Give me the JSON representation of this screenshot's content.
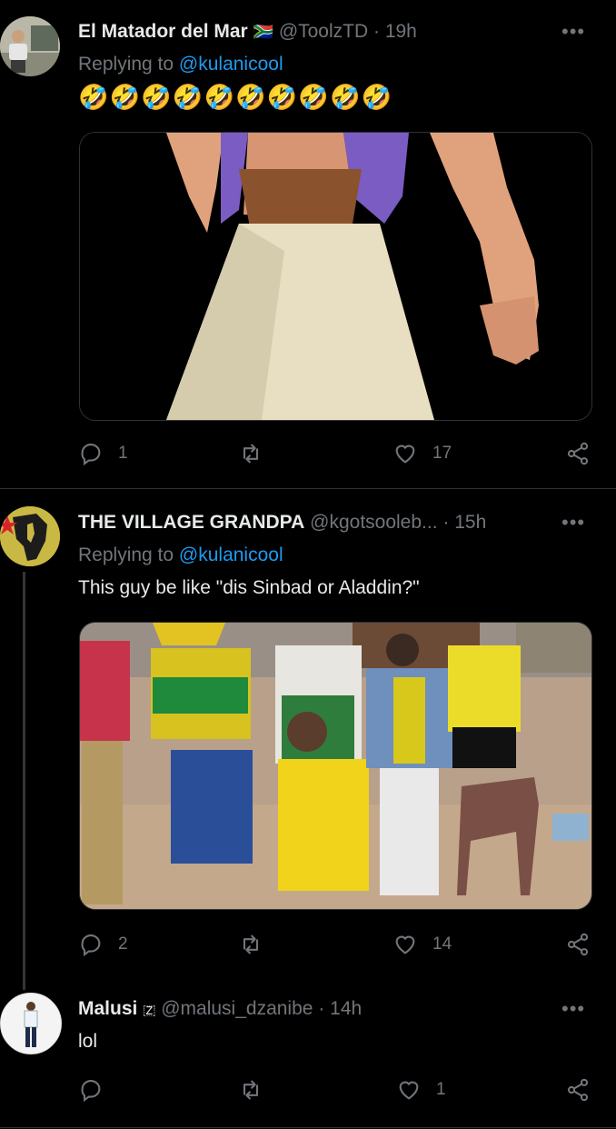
{
  "tweets": [
    {
      "name": "El Matador del Mar",
      "flag": "🇿🇦",
      "handle": "@ToolzTD",
      "time": "· 19h",
      "replying_label": "Replying to",
      "replying_to": "@kulanicool",
      "text": "🤣🤣🤣🤣🤣🤣🤣🤣🤣🤣",
      "replies": "1",
      "retweets": "",
      "likes": "17"
    },
    {
      "name": "THE VILLAGE GRANDPA",
      "handle": "@kgotsooleb...",
      "time": "· 15h",
      "replying_label": "Replying to",
      "replying_to": "@kulanicool",
      "text": "This guy be like \"dis Sinbad or Aladdin?\"",
      "replies": "2",
      "retweets": "",
      "likes": "14"
    },
    {
      "name": "Malusi",
      "name_suffix": "🇿",
      "handle": "@malusi_dzanibe",
      "time": "· 14h",
      "text": "lol",
      "replies": "",
      "retweets": "",
      "likes": "1"
    }
  ],
  "more_glyph": "•••",
  "colors": {
    "background": "#000000",
    "text": "#e7e9ea",
    "muted": "#71767b",
    "link": "#1d9bf0",
    "divider": "#2f3336"
  },
  "icons": [
    "reply-icon",
    "retweet-icon",
    "like-icon",
    "share-icon",
    "more-icon"
  ]
}
